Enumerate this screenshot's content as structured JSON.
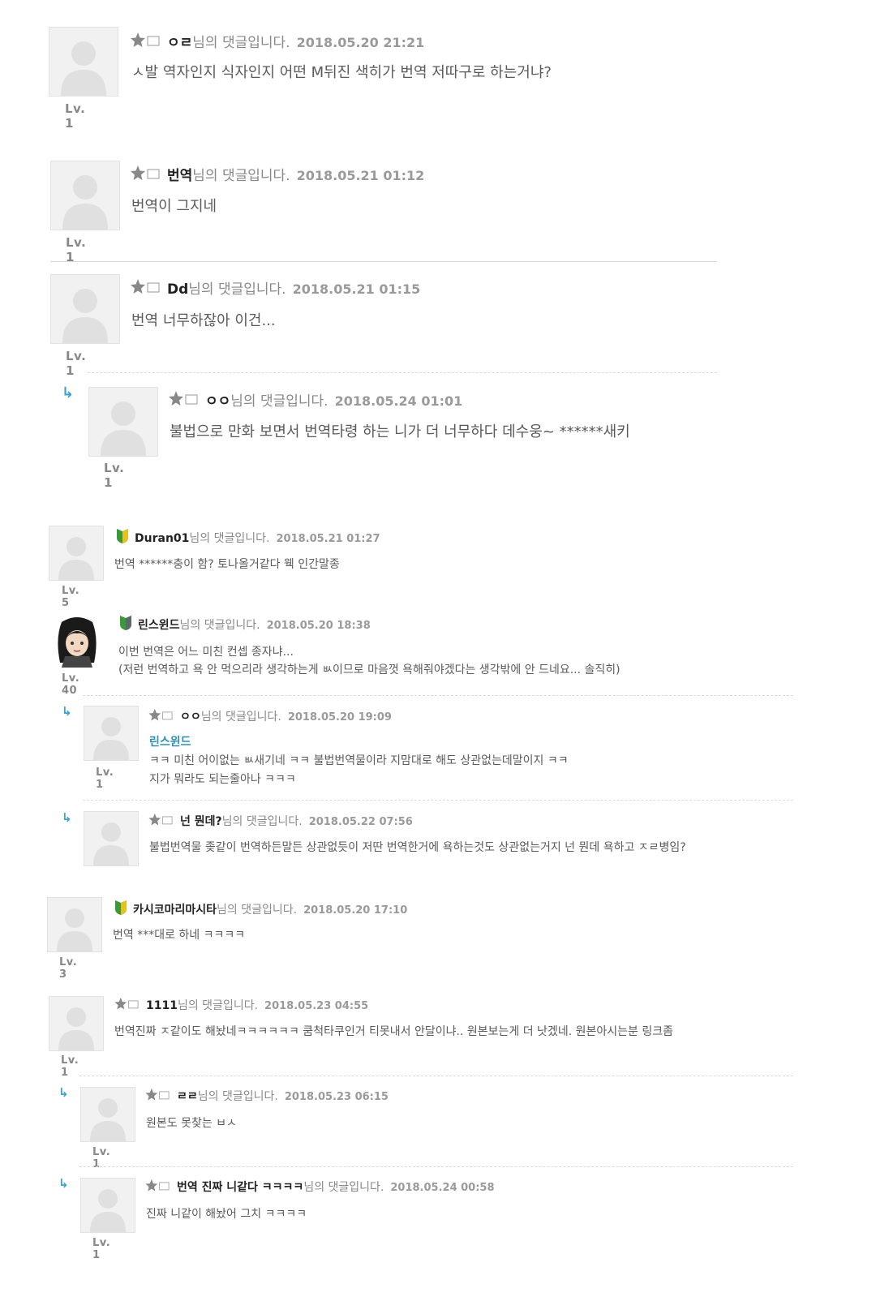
{
  "comment_suffix": "님의 댓글입니다.",
  "reply_arrow": "↳",
  "comments": [
    {
      "id": "c1",
      "nick": "ㅇㄹ",
      "date": "2018.05.20 21:21",
      "text": "ㅅ발 역자인지 식자인지 어떤 M뒤진 색히가 번역 저따구로 하는거냐?",
      "level": "Lv. 1",
      "badge": "star-icon"
    },
    {
      "id": "c2",
      "nick": "번역",
      "date": "2018.05.21 01:12",
      "text": "번역이 그지네",
      "level": "Lv. 1",
      "badge": "star-icon"
    },
    {
      "id": "c3",
      "nick": "Dd",
      "date": "2018.05.21 01:15",
      "text": "번역 너무하잖아 이건...",
      "level": "Lv. 1",
      "badge": "star-icon"
    },
    {
      "id": "c4",
      "nick": "ㅇㅇ",
      "date": "2018.05.24 01:01",
      "text": "불법으로 만화 보면서 번역타령 하는 니가 더 너무하다 데수웅~ ******새키",
      "level": "Lv. 1",
      "badge": "star-icon"
    },
    {
      "id": "c5",
      "nick": "Duran01",
      "date": "2018.05.21 01:27",
      "text": "번역 ******충이 함? 토나올거같다 웩 인간말종",
      "level": "Lv. 5",
      "badge": "leaf-icon"
    },
    {
      "id": "c6",
      "nick": "린스윈드",
      "date": "2018.05.20 18:38",
      "text": "이번 번역은 어느 미친 컨셉 종자냐...",
      "text2": "(저런 번역하고 욕 안 먹으리라 생각하는게 ㅄ이므로 마음껏 욕해줘야겠다는 생각밖에 안 드네요... 솔직히)",
      "level": "Lv. 40",
      "badge": "leaf-icon"
    },
    {
      "id": "c7",
      "nick": "ㅇㅇ",
      "date": "2018.05.20 19:09",
      "mention": "린스윈드",
      "text": "ㅋㅋ 미친 어이없는 ㅄ새기네 ㅋㅋ 불법번역물이라 지맘대로 해도 상관없는데말이지 ㅋㅋ",
      "text2": "지가 뭐라도 되는줄아나 ㅋㅋㅋ",
      "level": "Lv. 1",
      "badge": "star-icon"
    },
    {
      "id": "c8",
      "nick": "넌 뭔데?",
      "date": "2018.05.22 07:56",
      "text": "불법번역물 좆같이 번역하든말든 상관없듯이 저딴 번역한거에 욕하는것도 상관없는거지 넌 뭔데 욕하고 ㅈㄹ병임?",
      "level": "",
      "badge": "star-icon"
    },
    {
      "id": "c9",
      "nick": "카시코마리마시타",
      "date": "2018.05.20 17:10",
      "text": "번역 ***대로 하네 ㅋㅋㅋㅋ",
      "level": "Lv. 3",
      "badge": "leaf-icon"
    },
    {
      "id": "c10",
      "nick": "1111",
      "date": "2018.05.23 04:55",
      "text": "번역진짜 ㅈ같이도 해놨네ㅋㅋㅋㅋㅋㅋ 쿰척타쿠인거 티못내서 안달이냐.. 원본보는게 더 낫겠네. 원본아시는분 링크좀",
      "level": "Lv. 1",
      "badge": "star-icon"
    },
    {
      "id": "c11",
      "nick": "ㄹㄹ",
      "date": "2018.05.23 06:15",
      "text": "원본도 못찾는 ㅂㅅ",
      "level": "Lv. 1",
      "badge": "star-icon"
    },
    {
      "id": "c12",
      "nick": "번역 진짜 니같다 ㅋㅋㅋㅋ",
      "date": "2018.05.24 00:58",
      "text": "진짜 니같이 해놨어 그치 ㅋㅋㅋㅋ",
      "level": "Lv. 1",
      "badge": "star-icon"
    }
  ],
  "colors": {
    "nick": "#222222",
    "meta": "#888888",
    "body": "#5a5a5a",
    "mention": "#2f8fb3",
    "reply_arrow": "#39a0d8",
    "divider": "#dcdcdc"
  }
}
